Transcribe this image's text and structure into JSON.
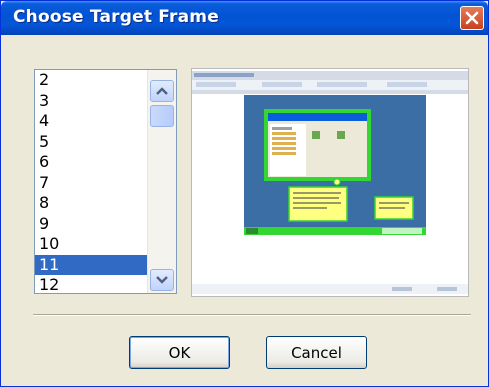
{
  "dialog": {
    "title": "Choose Target Frame",
    "close_icon": "close-icon"
  },
  "frame_list": {
    "items": [
      "2",
      "3",
      "4",
      "5",
      "6",
      "7",
      "8",
      "9",
      "10",
      "11",
      "12"
    ],
    "selected": "11",
    "scroll_up_icon": "chevron-up-icon",
    "scroll_down_icon": "chevron-down-icon"
  },
  "preview": {
    "description_icon": "frame-thumbnail"
  },
  "buttons": {
    "ok": "OK",
    "cancel": "Cancel"
  },
  "colors": {
    "titlebar": "#0353d4",
    "selection": "#316ac5",
    "dialog_bg": "#ece9d8",
    "close": "#d5532f",
    "highlight_green": "#33d633",
    "callout_yellow": "#ffff80",
    "desktop_blue": "#3a6ea5"
  }
}
